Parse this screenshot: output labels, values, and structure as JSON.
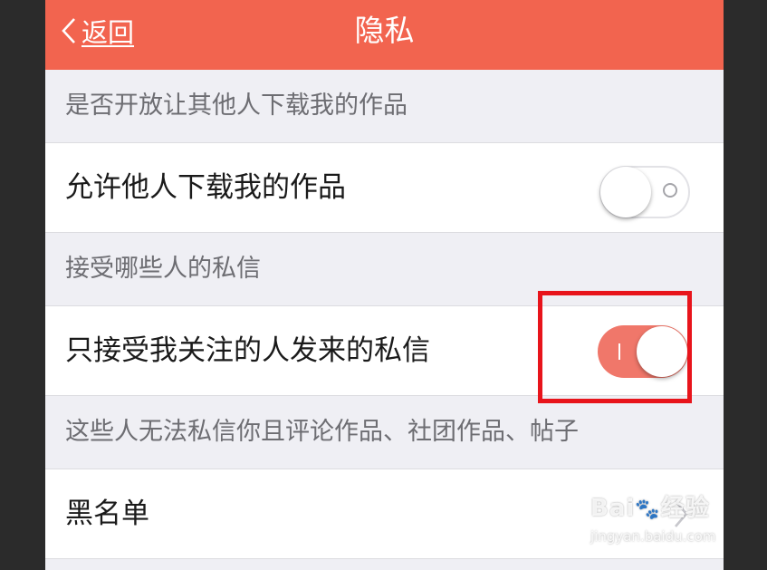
{
  "navbar": {
    "back_label": "返回",
    "title": "隐私",
    "background_color": "#f2644f"
  },
  "sections": [
    {
      "header": "是否开放让其他人下载我的作品",
      "cell": {
        "label": "允许他人下载我的作品",
        "toggle_state": "off"
      }
    },
    {
      "header": "接受哪些人的私信",
      "cell": {
        "label": "只接受我关注的人发来的私信",
        "toggle_state": "on",
        "toggle_color": "#f0776a"
      }
    },
    {
      "header": "这些人无法私信你且评论作品、社团作品、帖子",
      "cell": {
        "label": "黑名单",
        "accessory": "chevron-right-icon"
      }
    }
  ],
  "annotation": {
    "color": "#e8141b"
  },
  "watermark": {
    "logo": "Bai",
    "logo_tail": "经验",
    "url": "jingyan.baidu.com"
  }
}
